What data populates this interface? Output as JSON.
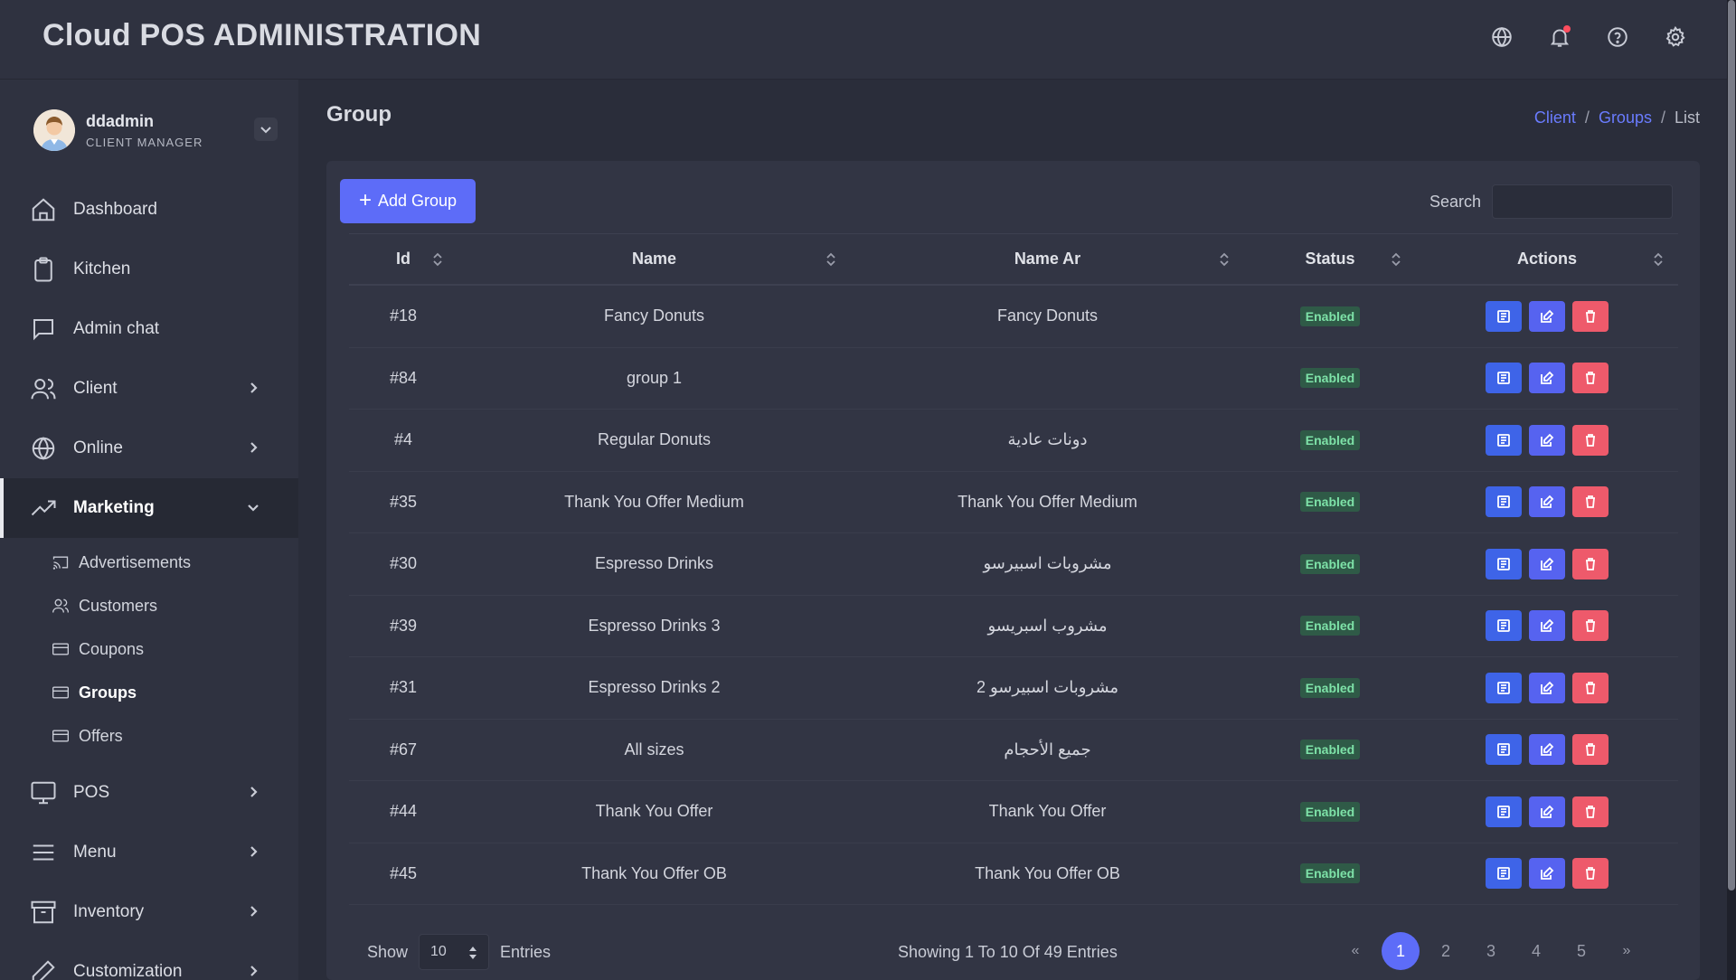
{
  "header": {
    "title": "Cloud POS ADMINISTRATION",
    "icons": [
      "globe-icon",
      "bell-icon",
      "help-icon",
      "gear-icon"
    ]
  },
  "user": {
    "name": "ddadmin",
    "role": "CLIENT MANAGER"
  },
  "sidebar": {
    "items": [
      {
        "label": "Dashboard",
        "icon": "home-icon"
      },
      {
        "label": "Kitchen",
        "icon": "clipboard-icon"
      },
      {
        "label": "Admin chat",
        "icon": "chat-icon"
      },
      {
        "label": "Client",
        "icon": "users-icon"
      },
      {
        "label": "Online",
        "icon": "globe-icon"
      },
      {
        "label": "Marketing",
        "icon": "trending-icon"
      },
      {
        "label": "POS",
        "icon": "monitor-icon"
      },
      {
        "label": "Menu",
        "icon": "menu-icon"
      },
      {
        "label": "Inventory",
        "icon": "archive-icon"
      },
      {
        "label": "Customization",
        "icon": "pen-icon"
      }
    ],
    "marketing_sub": [
      {
        "label": "Advertisements",
        "icon": "cast-icon"
      },
      {
        "label": "Customers",
        "icon": "users-icon"
      },
      {
        "label": "Coupons",
        "icon": "card-icon"
      },
      {
        "label": "Groups",
        "icon": "card-icon"
      },
      {
        "label": "Offers",
        "icon": "card-icon"
      }
    ]
  },
  "page": {
    "title": "Group",
    "breadcrumb": [
      "Client",
      "Groups",
      "List"
    ],
    "add_button": "Add Group",
    "search_label": "Search",
    "search_value": ""
  },
  "table": {
    "headers": [
      "Id",
      "Name",
      "Name Ar",
      "Status",
      "Actions"
    ],
    "rows": [
      {
        "id": "#18",
        "name": "Fancy Donuts",
        "name_ar": "Fancy Donuts",
        "status": "Enabled"
      },
      {
        "id": "#84",
        "name": "group 1",
        "name_ar": "",
        "status": "Enabled"
      },
      {
        "id": "#4",
        "name": "Regular Donuts",
        "name_ar": "دونات عادية",
        "status": "Enabled"
      },
      {
        "id": "#35",
        "name": "Thank You Offer Medium",
        "name_ar": "Thank You Offer Medium",
        "status": "Enabled"
      },
      {
        "id": "#30",
        "name": "Espresso Drinks",
        "name_ar": "مشروبات اسبيرسو",
        "status": "Enabled"
      },
      {
        "id": "#39",
        "name": "Espresso Drinks 3",
        "name_ar": "مشروب اسبريسو",
        "status": "Enabled"
      },
      {
        "id": "#31",
        "name": "Espresso Drinks 2",
        "name_ar": "مشروبات اسبيرسو 2",
        "status": "Enabled"
      },
      {
        "id": "#67",
        "name": "All sizes",
        "name_ar": "جميع الأحجام",
        "status": "Enabled"
      },
      {
        "id": "#44",
        "name": "Thank You Offer",
        "name_ar": "Thank You Offer",
        "status": "Enabled"
      },
      {
        "id": "#45",
        "name": "Thank You Offer OB",
        "name_ar": "Thank You Offer OB",
        "status": "Enabled"
      }
    ]
  },
  "footer": {
    "show_label": "Show",
    "entries_value": "10",
    "entries_label": "Entries",
    "showing_text": "Showing 1 To 10 Of 49 Entries",
    "pages": [
      "«",
      "1",
      "2",
      "3",
      "4",
      "5",
      "»"
    ],
    "active_page": "1"
  },
  "colors": {
    "accent": "#5d6cf8",
    "success_badge": "#7ee2a8",
    "danger": "#ee5a6b"
  }
}
